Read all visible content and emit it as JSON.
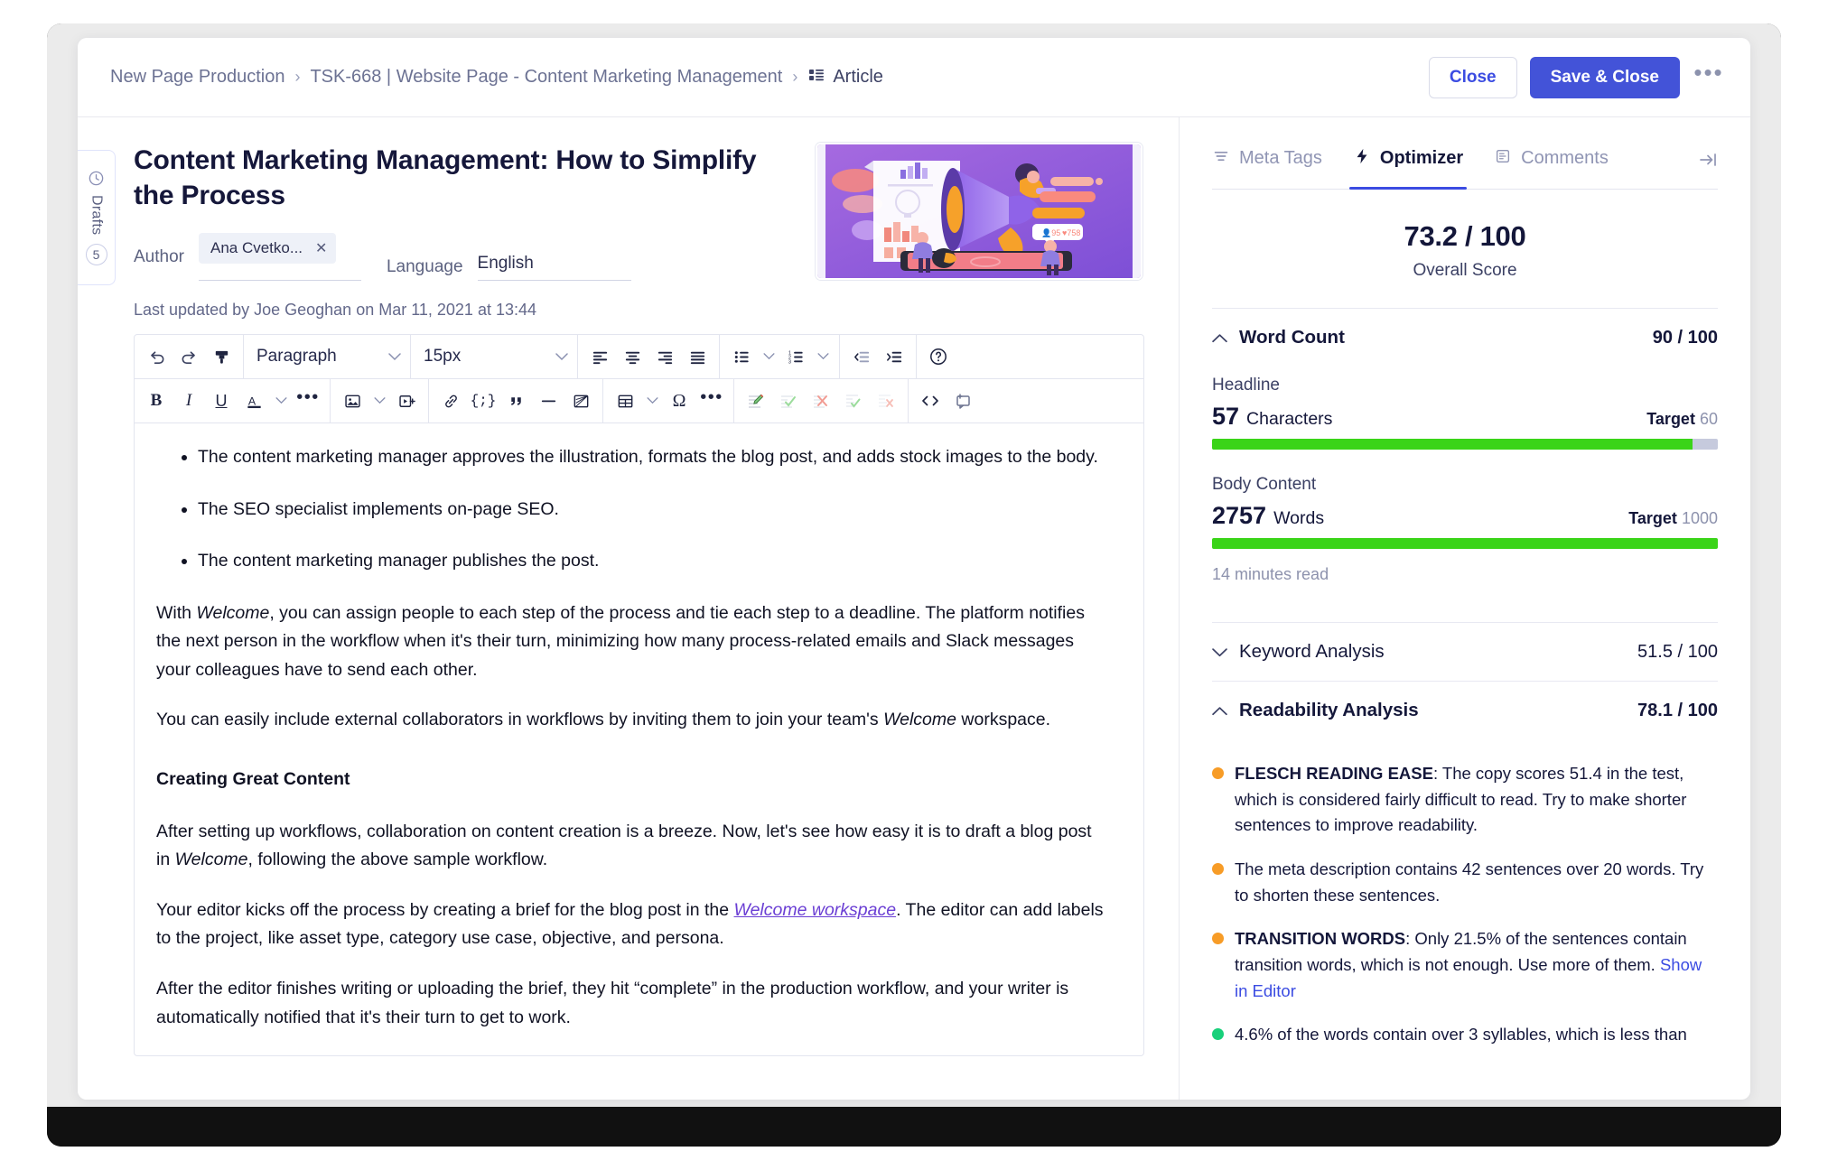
{
  "header": {
    "breadcrumb": [
      {
        "label": "New Page Production",
        "icon": null
      },
      {
        "label": "TSK-668 | Website Page - Content Marketing Management",
        "icon": null
      },
      {
        "label": "Article",
        "icon": "article-icon"
      }
    ],
    "separator": "›",
    "close_label": "Close",
    "save_close_label": "Save & Close",
    "more_label": "•••"
  },
  "drafts_rail": {
    "label": "Drafts",
    "badge": "5",
    "icon": "clock-icon"
  },
  "article": {
    "title": "Content Marketing Management: How to Simplify the Process",
    "author_label": "Author",
    "author_chip": "Ana Cvetko...",
    "author_chip_remove": "✕",
    "language_label": "Language",
    "language_value": "English",
    "last_updated": "Last updated by Joe Geoghan on Mar 11, 2021 at 13:44"
  },
  "toolbar": {
    "paragraph_style": "Paragraph",
    "font_size": "15px",
    "icons_row1": [
      "undo-icon",
      "redo-icon",
      "format-painter-icon",
      "align-left-icon",
      "align-center-icon",
      "align-right-icon",
      "align-justify-icon",
      "bulleted-list-icon",
      "numbered-list-icon",
      "outdent-icon",
      "indent-icon",
      "help-icon"
    ],
    "icons_row2": [
      "bold-icon",
      "italic-icon",
      "underline-icon",
      "text-color-icon",
      "more-text-format-icon",
      "insert-image-icon",
      "insert-media-icon",
      "insert-link-icon",
      "insert-code-icon",
      "blockquote-icon",
      "horizontal-rule-icon",
      "insert-chart-icon",
      "insert-table-icon",
      "special-character-icon",
      "more-insert-icon",
      "track-changes-icon",
      "accept-change-icon",
      "reject-change-icon",
      "accept-all-changes-icon",
      "reject-all-changes-icon",
      "source-code-icon",
      "comment-icon"
    ]
  },
  "document": {
    "bullets": [
      "The content marketing manager approves the illustration, formats the blog post, and adds stock images to the body.",
      "The SEO specialist implements on-page SEO.",
      "The content marketing manager publishes the post."
    ],
    "para1_a": "With ",
    "para1_em": "Welcome",
    "para1_b": ", you can assign people to each step of the process and tie each step to a deadline. The platform notifies the next person in the workflow when it's their turn, minimizing how many process-related emails and Slack messages your colleagues have to send each other.",
    "para2_a": "You can easily include external collaborators in workflows by inviting them to join your team's ",
    "para2_em": "Welcome",
    "para2_b": " workspace.",
    "heading": "Creating Great Content",
    "para3_a": "After setting up workflows, collaboration on content creation is a breeze. Now, let's see how easy it is to draft a blog post in ",
    "para3_em": "Welcome",
    "para3_b": ", following the above sample workflow.",
    "para4_a": "Your editor kicks off the process by creating a brief for the blog post in the ",
    "para4_link": "Welcome workspace",
    "para4_b": ". The editor can add labels to the project, like asset type, category use case, objective, and persona.",
    "para5": "After the editor finishes writing or uploading the brief, they hit “complete” in the production workflow, and your writer is automatically notified that it's their turn to get to work."
  },
  "optimizer": {
    "tabs": [
      {
        "label": "Meta Tags",
        "icon": "meta-tags-icon",
        "active": false
      },
      {
        "label": "Optimizer",
        "icon": "bolt-icon",
        "active": true
      },
      {
        "label": "Comments",
        "icon": "comments-icon",
        "active": false
      }
    ],
    "collapse_icon": "collapse-panel-icon",
    "overall_score": "73.2 / 100",
    "overall_score_label": "Overall Score",
    "word_count": {
      "title": "Word Count",
      "score": "90 / 100",
      "expanded": true,
      "headline_label": "Headline",
      "headline_value": "57",
      "headline_unit": "Characters",
      "headline_target_label": "Target",
      "headline_target": "60",
      "headline_pct": 95,
      "body_label": "Body Content",
      "body_value": "2757",
      "body_unit": "Words",
      "body_target_label": "Target",
      "body_target": "1000",
      "body_pct": 100,
      "read_time": "14 minutes read"
    },
    "keyword_analysis": {
      "title": "Keyword Analysis",
      "score": "51.5 / 100",
      "expanded": false
    },
    "readability_analysis": {
      "title": "Readability Analysis",
      "score": "78.1 / 100",
      "expanded": true
    },
    "tips": [
      {
        "color": "orange",
        "bold": "FLESCH READING EASE",
        "text": ": The copy scores 51.4 in the test, which is considered fairly difficult to read. Try to make shorter sentences to improve readability.",
        "link": null
      },
      {
        "color": "orange",
        "bold": "",
        "text": "The meta description contains 42 sentences over 20 words. Try to shorten these sentences.",
        "link": null
      },
      {
        "color": "orange",
        "bold": "TRANSITION WORDS",
        "text": ": Only 21.5% of the sentences contain transition words, which is not enough. Use more of them. ",
        "link": "Show in Editor"
      },
      {
        "color": "green",
        "bold": "",
        "text": "4.6% of the words contain over 3 syllables, which is less than",
        "link": null
      }
    ]
  },
  "colors": {
    "accent": "#3b4ce2",
    "primary_button": "#4353d8",
    "progress_green": "#3ad418",
    "tip_orange": "#f79c27",
    "tip_green": "#18d07a",
    "link_purple": "#6b3fd4"
  }
}
